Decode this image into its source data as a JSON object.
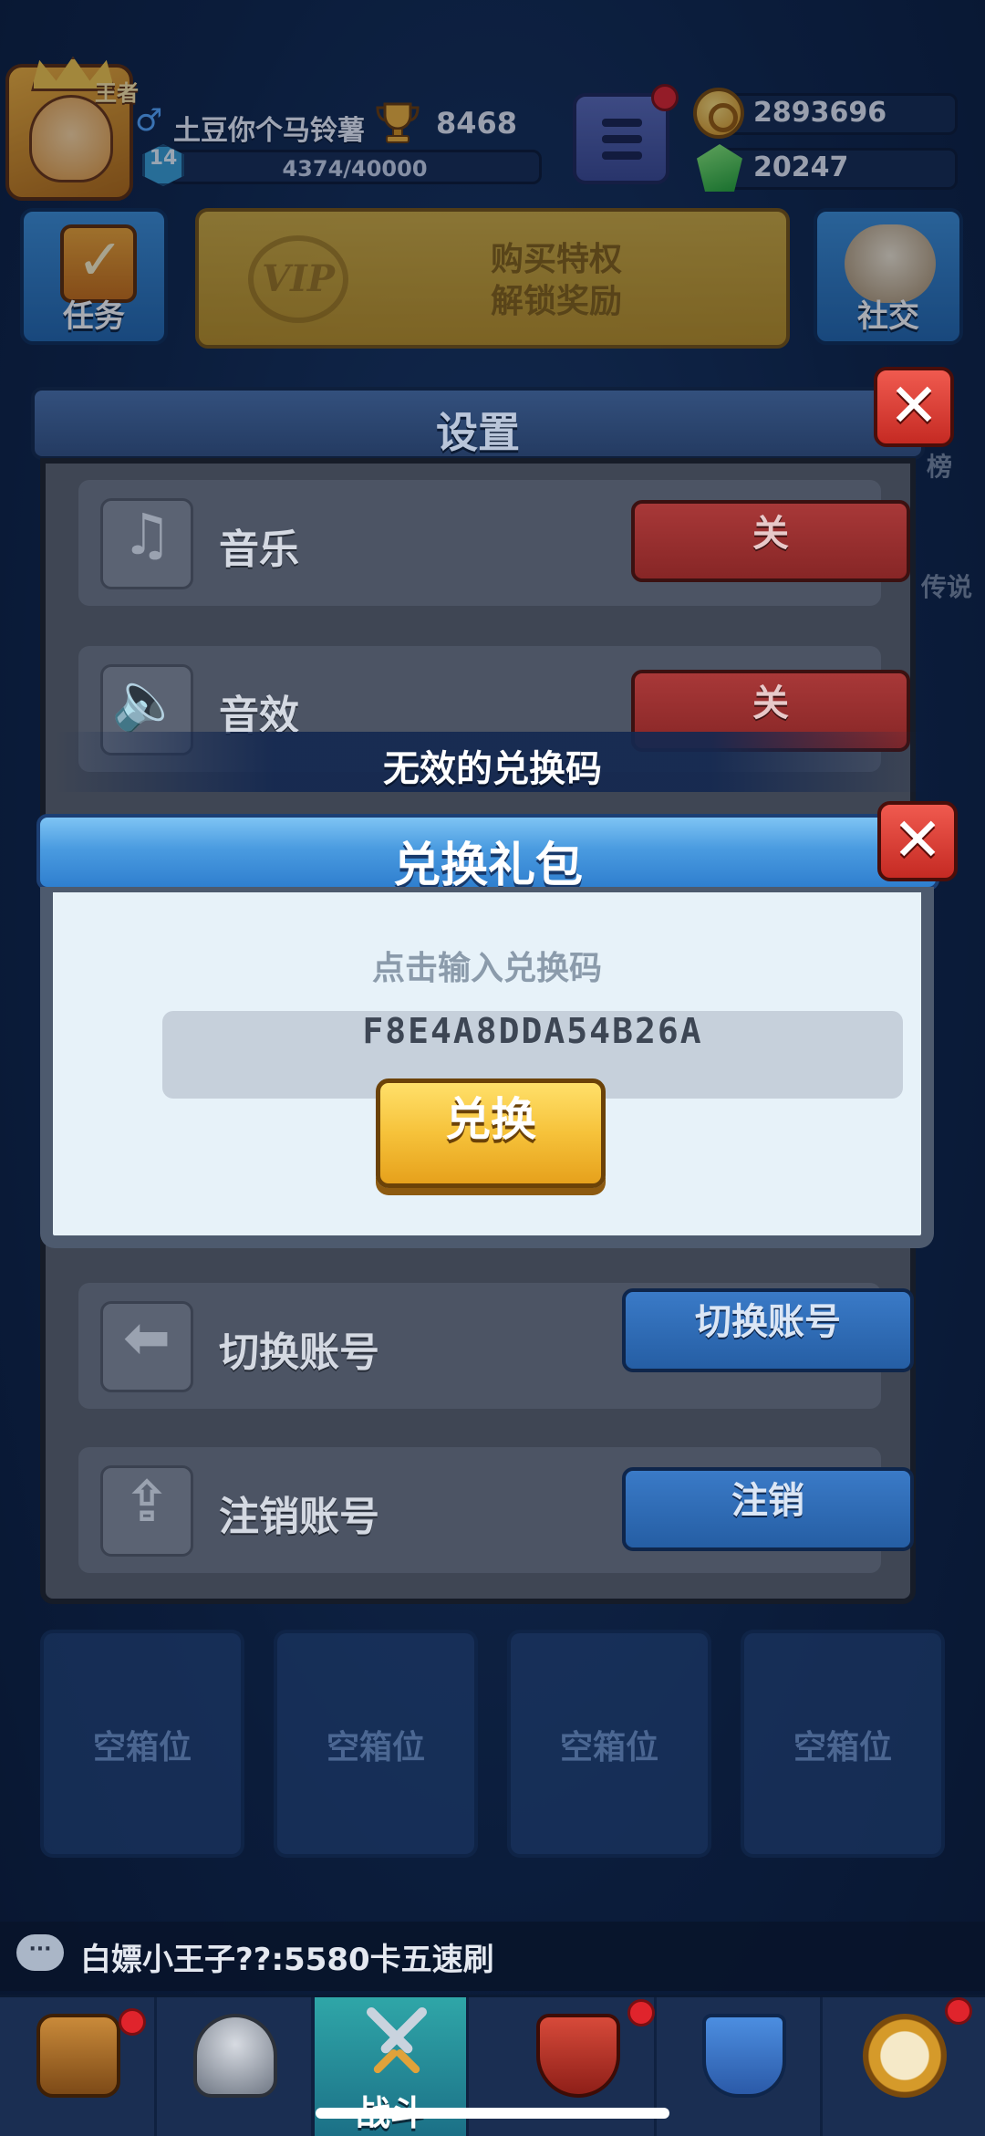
{
  "player": {
    "avatar_tag": "王者",
    "name": "土豆你个马铃薯",
    "trophies": "8468",
    "level": "14",
    "xp": "4374/40000"
  },
  "currency": {
    "gold": "2893696",
    "gems": "20247"
  },
  "top_buttons": {
    "task_label": "任务",
    "vip_line1": "购买特权",
    "vip_line2": "解锁奖励",
    "vip_badge": "VIP",
    "social_label": "社交"
  },
  "side_faded": {
    "right_1": "榜",
    "right_2": "传说"
  },
  "settings": {
    "title": "设置",
    "rows": [
      {
        "label": "音乐",
        "button": "关"
      },
      {
        "label": "音效",
        "button": "关"
      },
      {
        "label": "切换账号",
        "button": "切换账号"
      },
      {
        "label": "注销账号",
        "button": "注销"
      }
    ]
  },
  "toast": "无效的兑换码",
  "redeem": {
    "title": "兑换礼包",
    "hint": "点击输入兑换码",
    "code_value": "F8E4A8DDA54B26A",
    "button": "兑换"
  },
  "slots": [
    "空箱位",
    "空箱位",
    "空箱位",
    "空箱位"
  ],
  "chat": {
    "icon": "···",
    "message": "白嫖小王子??:5580卡五速刷"
  },
  "nav": {
    "active_label": "战斗"
  },
  "colors": {
    "accent_yellow": "#f6c23a",
    "close_red": "#d8362c",
    "dialog_blue": "#4a9be0"
  }
}
